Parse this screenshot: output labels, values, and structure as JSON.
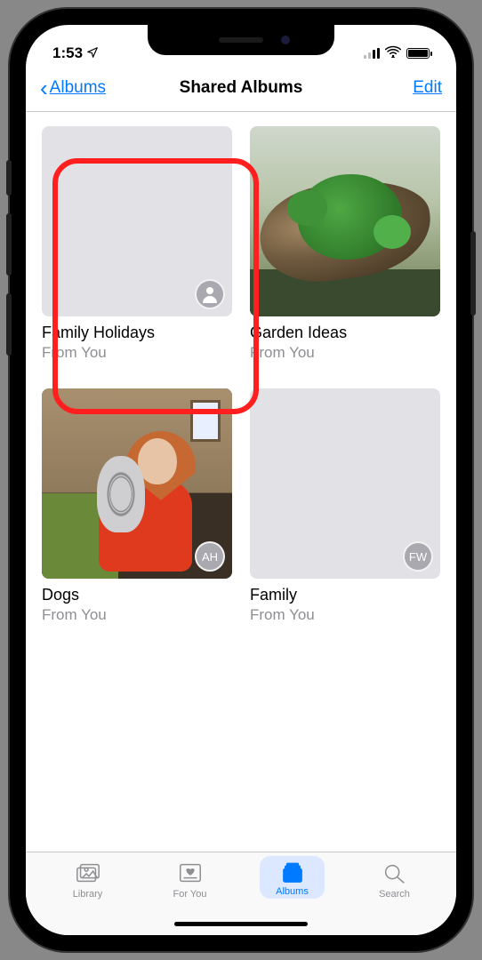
{
  "status": {
    "time": "1:53"
  },
  "nav": {
    "back_label": "Albums",
    "title": "Shared Albums",
    "edit_label": "Edit"
  },
  "albums": [
    {
      "title": "Family Holidays",
      "subtitle": "From You",
      "badge_type": "person",
      "badge_text": ""
    },
    {
      "title": "Garden Ideas",
      "subtitle": "From You",
      "badge_type": "none",
      "badge_text": ""
    },
    {
      "title": "Dogs",
      "subtitle": "From You",
      "badge_type": "text",
      "badge_text": "AH"
    },
    {
      "title": "Family",
      "subtitle": "From You",
      "badge_type": "text",
      "badge_text": "FW"
    }
  ],
  "tabs": {
    "library": "Library",
    "for_you": "For You",
    "albums": "Albums",
    "search": "Search"
  }
}
